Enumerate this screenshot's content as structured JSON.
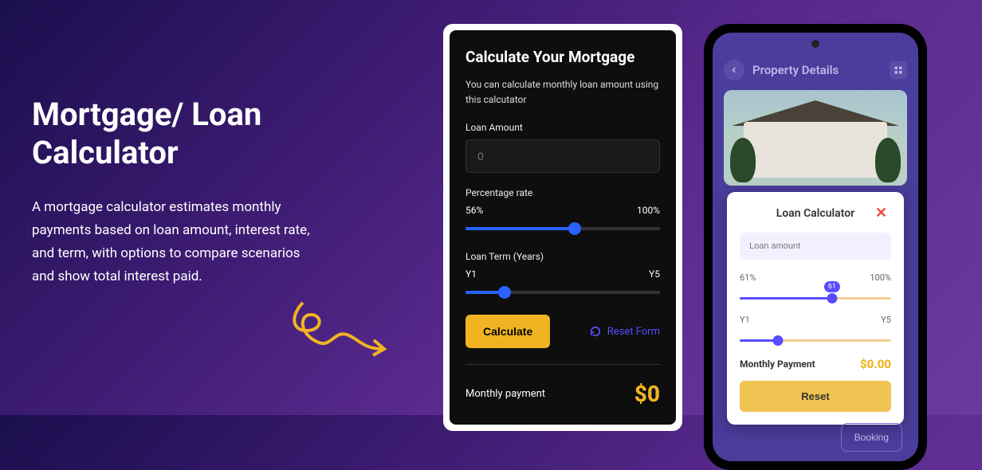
{
  "left": {
    "title": "Mortgage/ Loan Calculator",
    "desc": "A mortgage calculator estimates monthly payments based on loan amount, interest rate, and term, with options to compare scenarios and show total interest paid."
  },
  "calc": {
    "title": "Calculate Your Mortgage",
    "subtitle": "You can calculate monthly loan amount using this calcutator",
    "loan_label": "Loan Amount",
    "loan_placeholder": "0",
    "rate_label": "Percentage rate",
    "rate_min_label": "56%",
    "rate_max_label": "100%",
    "rate_fill_pct": 56,
    "term_label": "Loan Term (Years)",
    "term_min_label": "Y1",
    "term_max_label": "Y5",
    "term_fill_pct": 20,
    "calculate_label": "Calculate",
    "reset_label": "Reset Form",
    "payment_label": "Monthly payment",
    "payment_value": "$0"
  },
  "phone": {
    "header_title": "Property Details",
    "popup": {
      "title": "Loan Calculator",
      "amount_placeholder": "Loan amount",
      "rate_min": "61%",
      "rate_max": "100%",
      "rate_bubble": "61",
      "rate_fill_pct": 61,
      "term_min": "Y1",
      "term_max": "Y5",
      "term_fill_pct": 25,
      "pay_label": "Monthly Payment",
      "pay_value": "$0.00",
      "reset_label": "Reset"
    },
    "booking_label": "Booking"
  }
}
